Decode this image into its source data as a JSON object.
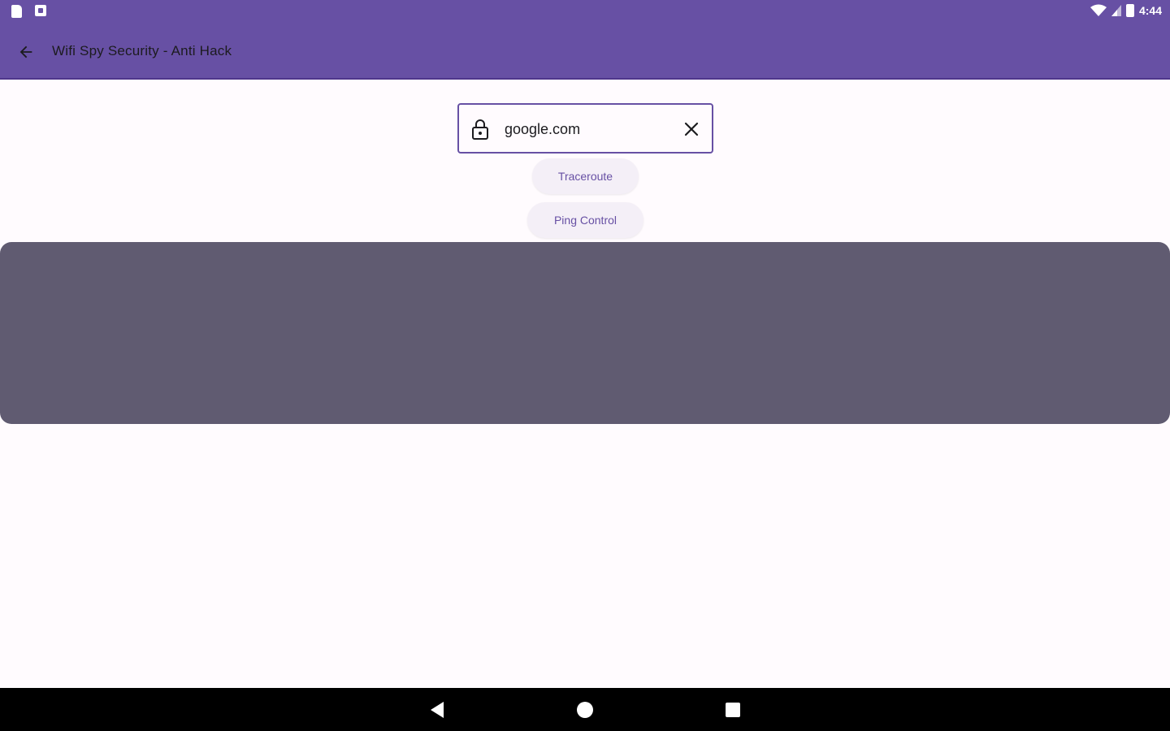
{
  "status_bar": {
    "time": "4:44",
    "icons": [
      "sd-card-icon",
      "notification-icon",
      "wifi-icon",
      "signal-icon",
      "battery-icon"
    ]
  },
  "toolbar": {
    "title": "Wifi Spy Security - Anti Hack",
    "back_icon": "arrow-back-icon"
  },
  "search": {
    "value": "google.com",
    "lock_icon": "lock-icon",
    "clear_icon": "close-icon"
  },
  "actions": {
    "traceroute_label": "Traceroute",
    "ping_label": "Ping Control"
  },
  "colors": {
    "primary": "#6750a4",
    "panel": "#605b71",
    "background": "#fffbfe",
    "pill_background": "#f4eff7"
  },
  "nav_bar": {
    "icons": [
      "nav-back-icon",
      "nav-home-icon",
      "nav-recents-icon"
    ]
  }
}
